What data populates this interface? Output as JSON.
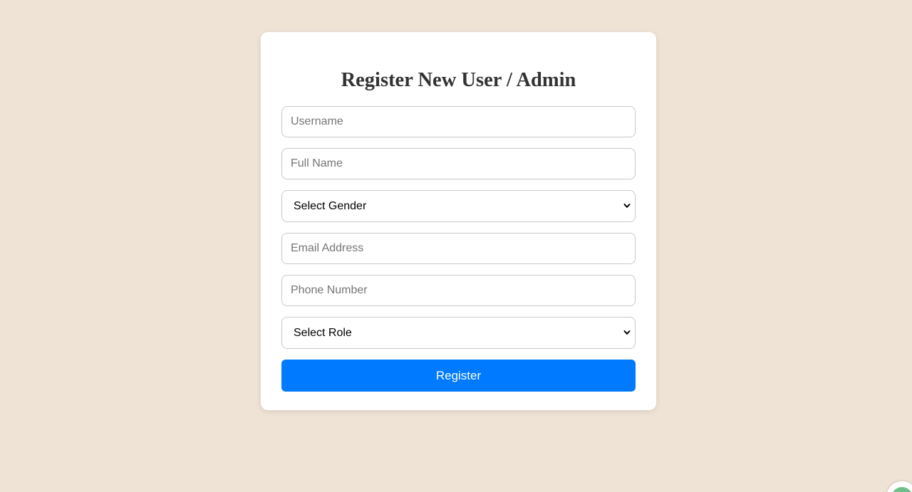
{
  "form": {
    "title": "Register New User / Admin",
    "fields": {
      "username": {
        "placeholder": "Username",
        "value": ""
      },
      "full_name": {
        "placeholder": "Full Name",
        "value": ""
      },
      "gender": {
        "selected": "Select Gender"
      },
      "email": {
        "placeholder": "Email Address",
        "value": ""
      },
      "phone": {
        "placeholder": "Phone Number",
        "value": ""
      },
      "role": {
        "selected": "Select Role"
      }
    },
    "submit_label": "Register"
  },
  "colors": {
    "page_background": "#efe3d6",
    "card_background": "#ffffff",
    "primary_button": "#007bff",
    "title_text": "#333333"
  },
  "icons": {
    "select_arrow": "chevron-down-icon",
    "corner_widget": "chat-widget-icon"
  }
}
